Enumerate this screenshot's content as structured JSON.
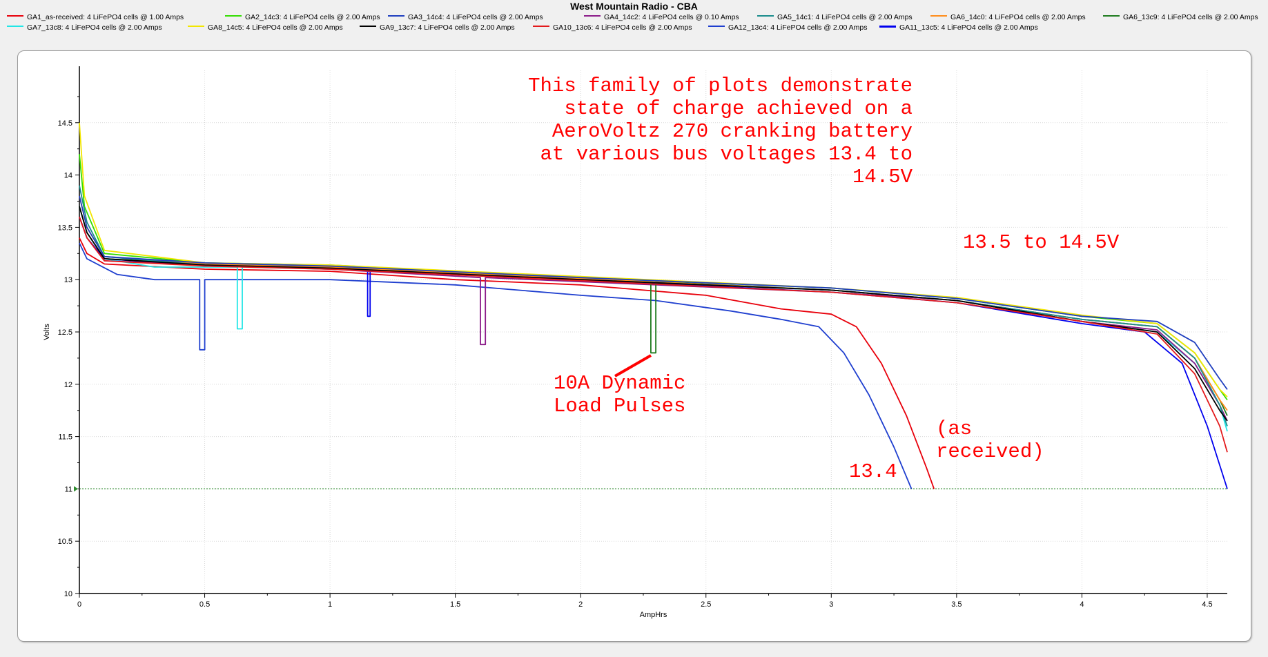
{
  "app_title": "West Mountain Radio - CBA",
  "colors": {
    "annotation": "#ff0000",
    "grid": "#d9d9d9",
    "cutoff": "#2e8b2e",
    "panel_bg": "#ffffff"
  },
  "legend": [
    {
      "label": "GA1_as-received: 4 LiFePO4 cells @ 1.00 Amps",
      "color": "#e8000b"
    },
    {
      "label": "GA2_14c3: 4 LiFePO4 cells @ 2.00 Amps",
      "color": "#33dd00"
    },
    {
      "label": "GA3_14c4: 4 LiFePO4 cells @ 2.00 Amps",
      "color": "#1f3fbf"
    },
    {
      "label": "GA4_14c2: 4 LiFePO4 cells @ 0.10 Amps",
      "color": "#8b1a89"
    },
    {
      "label": "GA5_14c1: 4 LiFePO4 cells @ 2.00 Amps",
      "color": "#1a8c8c"
    },
    {
      "label": "GA6_14c0: 4 LiFePO4 cells @ 2.00 Amps",
      "color": "#ff8c1a"
    },
    {
      "label": "GA6_13c9: 4 LiFePO4 cells @ 2.00 Amps",
      "color": "#1e7b1e"
    },
    {
      "label": "GA7_13c8: 4 LiFePO4 cells @ 2.00 Amps",
      "color": "#22e6e6"
    },
    {
      "label": "GA8_14c5: 4 LiFePO4 cells @ 2.00 Amps",
      "color": "#f2e600"
    },
    {
      "label": "GA9_13c7: 4 LiFePO4 cells @ 2.00 Amps",
      "color": "#000000"
    },
    {
      "label": "GA10_13c6: 4 LiFePO4 cells @ 2.00 Amps",
      "color": "#e31a1c"
    },
    {
      "label": "GA12_13c4: 4 LiFePO4 cells @ 2.00 Amps",
      "color": "#1f3fcf"
    },
    {
      "label": "GA11_13c5: 4 LiFePO4 cells @ 2.00 Amps",
      "color": "#0000ee"
    }
  ],
  "chart_data": {
    "type": "line",
    "title": "West Mountain Radio - CBA",
    "xlabel": "AmpHrs",
    "ylabel": "Volts",
    "xlim": [
      0,
      4.58
    ],
    "ylim": [
      10,
      15
    ],
    "x_ticks": [
      "0",
      "0.5",
      "1",
      "1.5",
      "2",
      "2.5",
      "3",
      "3.5",
      "4",
      "4.5"
    ],
    "y_ticks": [
      "10",
      "10.5",
      "11",
      "11.5",
      "12",
      "12.5",
      "13",
      "13.5",
      "14",
      "14.5"
    ],
    "grid": true,
    "cutoff_voltage": 11,
    "series": [
      {
        "name": "GA1_as-received: 4 LiFePO4 cells @ 1.00 Amps",
        "color": "#e8000b",
        "points": [
          [
            0,
            13.4
          ],
          [
            0.03,
            13.25
          ],
          [
            0.1,
            13.15
          ],
          [
            0.5,
            13.1
          ],
          [
            1,
            13.08
          ],
          [
            1.5,
            13.0
          ],
          [
            2,
            12.95
          ],
          [
            2.5,
            12.85
          ],
          [
            2.8,
            12.72
          ],
          [
            3.0,
            12.67
          ],
          [
            3.1,
            12.55
          ],
          [
            3.2,
            12.2
          ],
          [
            3.3,
            11.7
          ],
          [
            3.38,
            11.2
          ],
          [
            3.41,
            11.0
          ]
        ]
      },
      {
        "name": "GA12_13c4: 4 LiFePO4 cells @ 2.00 Amps",
        "color": "#1f3fcf",
        "points": [
          [
            0,
            13.35
          ],
          [
            0.03,
            13.2
          ],
          [
            0.15,
            13.05
          ],
          [
            0.3,
            13.0
          ],
          [
            0.48,
            13.0
          ],
          [
            0.48,
            12.33
          ],
          [
            0.5,
            12.33
          ],
          [
            0.5,
            13.0
          ],
          [
            1,
            13.0
          ],
          [
            1.5,
            12.95
          ],
          [
            2,
            12.85
          ],
          [
            2.3,
            12.8
          ],
          [
            2.6,
            12.7
          ],
          [
            2.8,
            12.62
          ],
          [
            2.95,
            12.55
          ],
          [
            3.05,
            12.3
          ],
          [
            3.15,
            11.9
          ],
          [
            3.25,
            11.4
          ],
          [
            3.32,
            11.0
          ]
        ]
      },
      {
        "name": "GA7_13c8: 4 LiFePO4 cells @ 2.00 Amps",
        "color": "#22e6e6",
        "points": [
          [
            0,
            13.7
          ],
          [
            0.03,
            13.45
          ],
          [
            0.1,
            13.2
          ],
          [
            0.3,
            13.12
          ],
          [
            0.63,
            13.12
          ],
          [
            0.63,
            12.53
          ],
          [
            0.65,
            12.53
          ],
          [
            0.65,
            13.12
          ],
          [
            1,
            13.1
          ],
          [
            2,
            13.0
          ],
          [
            3,
            12.9
          ],
          [
            3.5,
            12.8
          ],
          [
            4,
            12.6
          ],
          [
            4.3,
            12.5
          ],
          [
            4.45,
            12.2
          ],
          [
            4.55,
            11.8
          ],
          [
            4.58,
            11.55
          ]
        ]
      },
      {
        "name": "GA11_13c5: 4 LiFePO4 cells @ 2.00 Amps",
        "color": "#0000ee",
        "points": [
          [
            0,
            13.6
          ],
          [
            0.03,
            13.4
          ],
          [
            0.1,
            13.2
          ],
          [
            0.5,
            13.13
          ],
          [
            1.15,
            13.1
          ],
          [
            1.15,
            12.65
          ],
          [
            1.16,
            12.65
          ],
          [
            1.16,
            13.1
          ],
          [
            2,
            13.0
          ],
          [
            3,
            12.88
          ],
          [
            3.5,
            12.78
          ],
          [
            4,
            12.58
          ],
          [
            4.25,
            12.5
          ],
          [
            4.4,
            12.2
          ],
          [
            4.5,
            11.6
          ],
          [
            4.58,
            11.0
          ]
        ]
      },
      {
        "name": "GA4_14c2: 4 LiFePO4 cells @ 0.10 Amps",
        "color": "#8b1a89",
        "points": [
          [
            0,
            13.6
          ],
          [
            0.03,
            13.4
          ],
          [
            0.1,
            13.18
          ],
          [
            0.5,
            13.14
          ],
          [
            1,
            13.1
          ],
          [
            1.6,
            13.02
          ],
          [
            1.6,
            12.38
          ],
          [
            1.62,
            12.38
          ],
          [
            1.62,
            13.02
          ],
          [
            2,
            12.98
          ],
          [
            3,
            12.88
          ],
          [
            3.5,
            12.8
          ],
          [
            4,
            12.6
          ],
          [
            4.3,
            12.52
          ],
          [
            4.45,
            12.2
          ],
          [
            4.55,
            11.8
          ],
          [
            4.58,
            11.65
          ]
        ]
      },
      {
        "name": "GA6_13c9: 4 LiFePO4 cells @ 2.00 Amps",
        "color": "#1e7b1e",
        "points": [
          [
            0,
            13.7
          ],
          [
            0.03,
            13.45
          ],
          [
            0.1,
            13.2
          ],
          [
            0.5,
            13.15
          ],
          [
            1,
            13.12
          ],
          [
            2,
            13.0
          ],
          [
            2.28,
            12.98
          ],
          [
            2.28,
            12.3
          ],
          [
            2.3,
            12.3
          ],
          [
            2.3,
            12.98
          ],
          [
            3,
            12.9
          ],
          [
            3.5,
            12.8
          ],
          [
            4,
            12.62
          ],
          [
            4.3,
            12.55
          ],
          [
            4.45,
            12.25
          ],
          [
            4.55,
            11.85
          ],
          [
            4.58,
            11.7
          ]
        ]
      },
      {
        "name": "GA2_14c3: 4 LiFePO4 cells @ 2.00 Amps",
        "color": "#33dd00",
        "points": [
          [
            0,
            14.2
          ],
          [
            0.02,
            13.7
          ],
          [
            0.1,
            13.25
          ],
          [
            0.5,
            13.16
          ],
          [
            1,
            13.14
          ],
          [
            2,
            13.02
          ],
          [
            3,
            12.92
          ],
          [
            3.5,
            12.82
          ],
          [
            4,
            12.65
          ],
          [
            4.3,
            12.58
          ],
          [
            4.45,
            12.3
          ],
          [
            4.55,
            11.95
          ],
          [
            4.58,
            11.85
          ]
        ]
      },
      {
        "name": "GA8_14c5: 4 LiFePO4 cells @ 2.00 Amps",
        "color": "#f2e600",
        "points": [
          [
            0,
            14.5
          ],
          [
            0.02,
            13.8
          ],
          [
            0.1,
            13.28
          ],
          [
            0.5,
            13.16
          ],
          [
            1,
            13.14
          ],
          [
            2,
            13.03
          ],
          [
            3,
            12.92
          ],
          [
            3.5,
            12.83
          ],
          [
            4,
            12.66
          ],
          [
            4.3,
            12.58
          ],
          [
            4.45,
            12.3
          ],
          [
            4.55,
            11.95
          ],
          [
            4.58,
            11.88
          ]
        ]
      },
      {
        "name": "GA6_14c0: 4 LiFePO4 cells @ 2.00 Amps",
        "color": "#ff8c1a",
        "points": [
          [
            0,
            13.8
          ],
          [
            0.03,
            13.5
          ],
          [
            0.1,
            13.22
          ],
          [
            0.5,
            13.15
          ],
          [
            1,
            13.12
          ],
          [
            2,
            13.01
          ],
          [
            3,
            12.9
          ],
          [
            3.5,
            12.8
          ],
          [
            4,
            12.62
          ],
          [
            4.3,
            12.55
          ],
          [
            4.45,
            12.25
          ],
          [
            4.55,
            11.85
          ],
          [
            4.58,
            11.75
          ]
        ]
      },
      {
        "name": "GA5_14c1: 4 LiFePO4 cells @ 2.00 Amps",
        "color": "#1a8c8c",
        "points": [
          [
            0,
            13.9
          ],
          [
            0.03,
            13.55
          ],
          [
            0.1,
            13.22
          ],
          [
            0.5,
            13.14
          ],
          [
            1,
            13.11
          ],
          [
            2,
            13.0
          ],
          [
            3,
            12.9
          ],
          [
            3.5,
            12.8
          ],
          [
            4,
            12.62
          ],
          [
            4.3,
            12.55
          ],
          [
            4.45,
            12.25
          ],
          [
            4.55,
            11.8
          ],
          [
            4.58,
            11.6
          ]
        ]
      },
      {
        "name": "GA9_13c7: 4 LiFePO4 cells @ 2.00 Amps",
        "color": "#000000",
        "points": [
          [
            0,
            13.7
          ],
          [
            0.03,
            13.45
          ],
          [
            0.1,
            13.2
          ],
          [
            0.5,
            13.14
          ],
          [
            1,
            13.11
          ],
          [
            2,
            13.0
          ],
          [
            3,
            12.9
          ],
          [
            3.5,
            12.8
          ],
          [
            4,
            12.6
          ],
          [
            4.3,
            12.5
          ],
          [
            4.45,
            12.15
          ],
          [
            4.55,
            11.75
          ],
          [
            4.58,
            11.65
          ]
        ]
      },
      {
        "name": "GA10_13c6: 4 LiFePO4 cells @ 2.00 Amps",
        "color": "#e31a1c",
        "points": [
          [
            0,
            13.6
          ],
          [
            0.03,
            13.4
          ],
          [
            0.1,
            13.18
          ],
          [
            0.5,
            13.13
          ],
          [
            1,
            13.1
          ],
          [
            2,
            12.99
          ],
          [
            3,
            12.88
          ],
          [
            3.5,
            12.78
          ],
          [
            4,
            12.6
          ],
          [
            4.3,
            12.48
          ],
          [
            4.45,
            12.1
          ],
          [
            4.55,
            11.6
          ],
          [
            4.58,
            11.35
          ]
        ]
      },
      {
        "name": "GA3_14c4: 4 LiFePO4 cells @ 2.00 Amps",
        "color": "#1f3fbf",
        "points": [
          [
            0,
            13.8
          ],
          [
            0.03,
            13.5
          ],
          [
            0.1,
            13.22
          ],
          [
            0.5,
            13.16
          ],
          [
            1,
            13.13
          ],
          [
            2,
            13.02
          ],
          [
            3,
            12.92
          ],
          [
            3.5,
            12.82
          ],
          [
            4,
            12.65
          ],
          [
            4.3,
            12.6
          ],
          [
            4.45,
            12.4
          ],
          [
            4.55,
            12.05
          ],
          [
            4.58,
            11.95
          ]
        ]
      }
    ],
    "annotations": [
      {
        "lines": [
          "This family of plots demonstrate",
          "state of charge achieved on a",
          "AeroVoltz 270 cranking battery",
          "at various bus voltages 13.4 to",
          "14.5V"
        ],
        "align": "end"
      },
      {
        "lines": [
          "13.5 to 14.5V"
        ],
        "align": "start"
      },
      {
        "lines": [
          "10A Dynamic",
          "Load Pulses"
        ],
        "align": "start"
      },
      {
        "lines": [
          "(as",
          "received)"
        ],
        "align": "start"
      },
      {
        "lines": [
          "13.4"
        ],
        "align": "start"
      }
    ]
  }
}
